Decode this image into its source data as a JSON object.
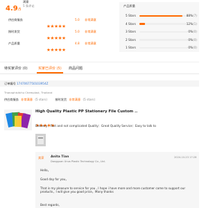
{
  "summary": {
    "score_big": "4.9",
    "score_suffix": "/5",
    "title": "満意",
    "count_text": "5 条评论"
  },
  "ratings_left": [
    {
      "label": "供应商服务",
      "score": "5.0",
      "tag": "非常满意",
      "stars": 5
    },
    {
      "label": "按时发货",
      "score": "5.0",
      "tag": "非常满意",
      "stars": 5
    },
    {
      "label": "产品质量",
      "score": "4.8",
      "tag": "非常满意",
      "stars": 5
    }
  ],
  "quality_panel": {
    "title": "产品质量",
    "rows": [
      {
        "label": "5 Stars",
        "pct_text": "88%",
        "count": "(7)",
        "fraction": 0.88
      },
      {
        "label": "4 Stars",
        "pct_text": "12%",
        "count": "(1)",
        "fraction": 0.12
      },
      {
        "label": "3 Stars",
        "pct_text": "0%",
        "count": "(0)",
        "fraction": 0
      },
      {
        "label": "2 Stars",
        "pct_text": "0%",
        "count": "(0)",
        "fraction": 0
      },
      {
        "label": "1 Stars",
        "pct_text": "0%",
        "count": "(0)",
        "fraction": 0
      }
    ]
  },
  "tabs": [
    {
      "label": "待买家评价 (0)",
      "active": false
    },
    {
      "label": "买家已评价 (5)",
      "active": true
    },
    {
      "label": "商品问题",
      "active": false
    }
  ],
  "review": {
    "order_label": "订单编号",
    "order_no": "1747067750103954Z",
    "buyer_name": "Thanaphisitchu Chemplast, Thailand",
    "supplier_label": "供应商服务",
    "supplier_value": "非常满意",
    "supplier_stars": "(5 stars)",
    "ontime_label": "按时发货",
    "ontime_value": "非常满意",
    "ontime_stars": "(5 stars)",
    "product_title": "High Quality Plastic PP Stationery File Custom ..",
    "product_stars": 5,
    "comment": "Delivery：Fast and not complicated Quality：Great Quality Service：Easy to talk to",
    "reply_badge": "卖家",
    "reply_name": "Anita Tian",
    "reply_company": "Dongguan Unus Plastic Technology Co., Ltd.",
    "reply_time": "2024-10-23 17:28",
    "reply_lines": [
      "Hello，",
      "Good day for you，",
      "That is my pleasure to service for you , I hope i have more and more customer come to support our products，I will give you good price，Many thanks",
      "Best regards,"
    ]
  },
  "colors": {
    "accent": "#ff6a00",
    "active_tab": "#ff6a00"
  }
}
